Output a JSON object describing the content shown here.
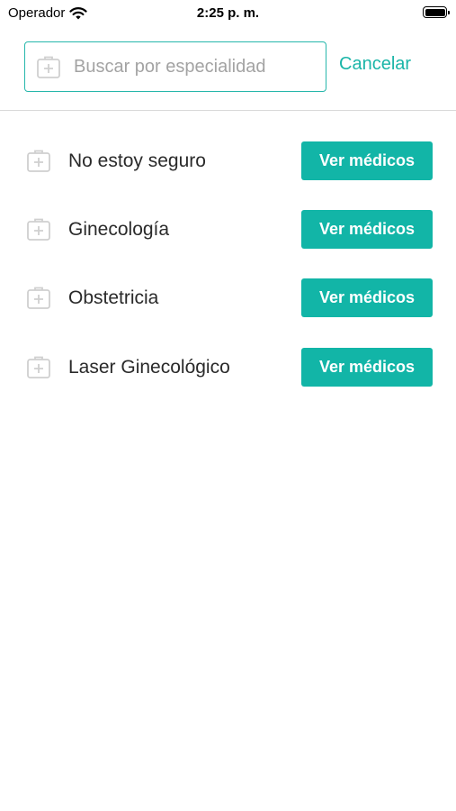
{
  "status_bar": {
    "carrier": "Operador",
    "time": "2:25 p. m."
  },
  "search": {
    "placeholder": "Buscar por especialidad",
    "value": "",
    "cancel_label": "Cancelar"
  },
  "specialties": [
    {
      "name": "No estoy seguro",
      "button_label": "Ver médicos"
    },
    {
      "name": "Ginecología",
      "button_label": "Ver médicos"
    },
    {
      "name": "Obstetricia",
      "button_label": "Ver médicos"
    },
    {
      "name": "Laser Ginecológico",
      "button_label": "Ver médicos"
    }
  ],
  "colors": {
    "accent": "#12b5a7",
    "cancel_text": "#1ab5a8",
    "icon_gray": "#cfcfcf"
  },
  "icons": {
    "search": "medical-kit-icon",
    "item": "medical-kit-icon"
  }
}
